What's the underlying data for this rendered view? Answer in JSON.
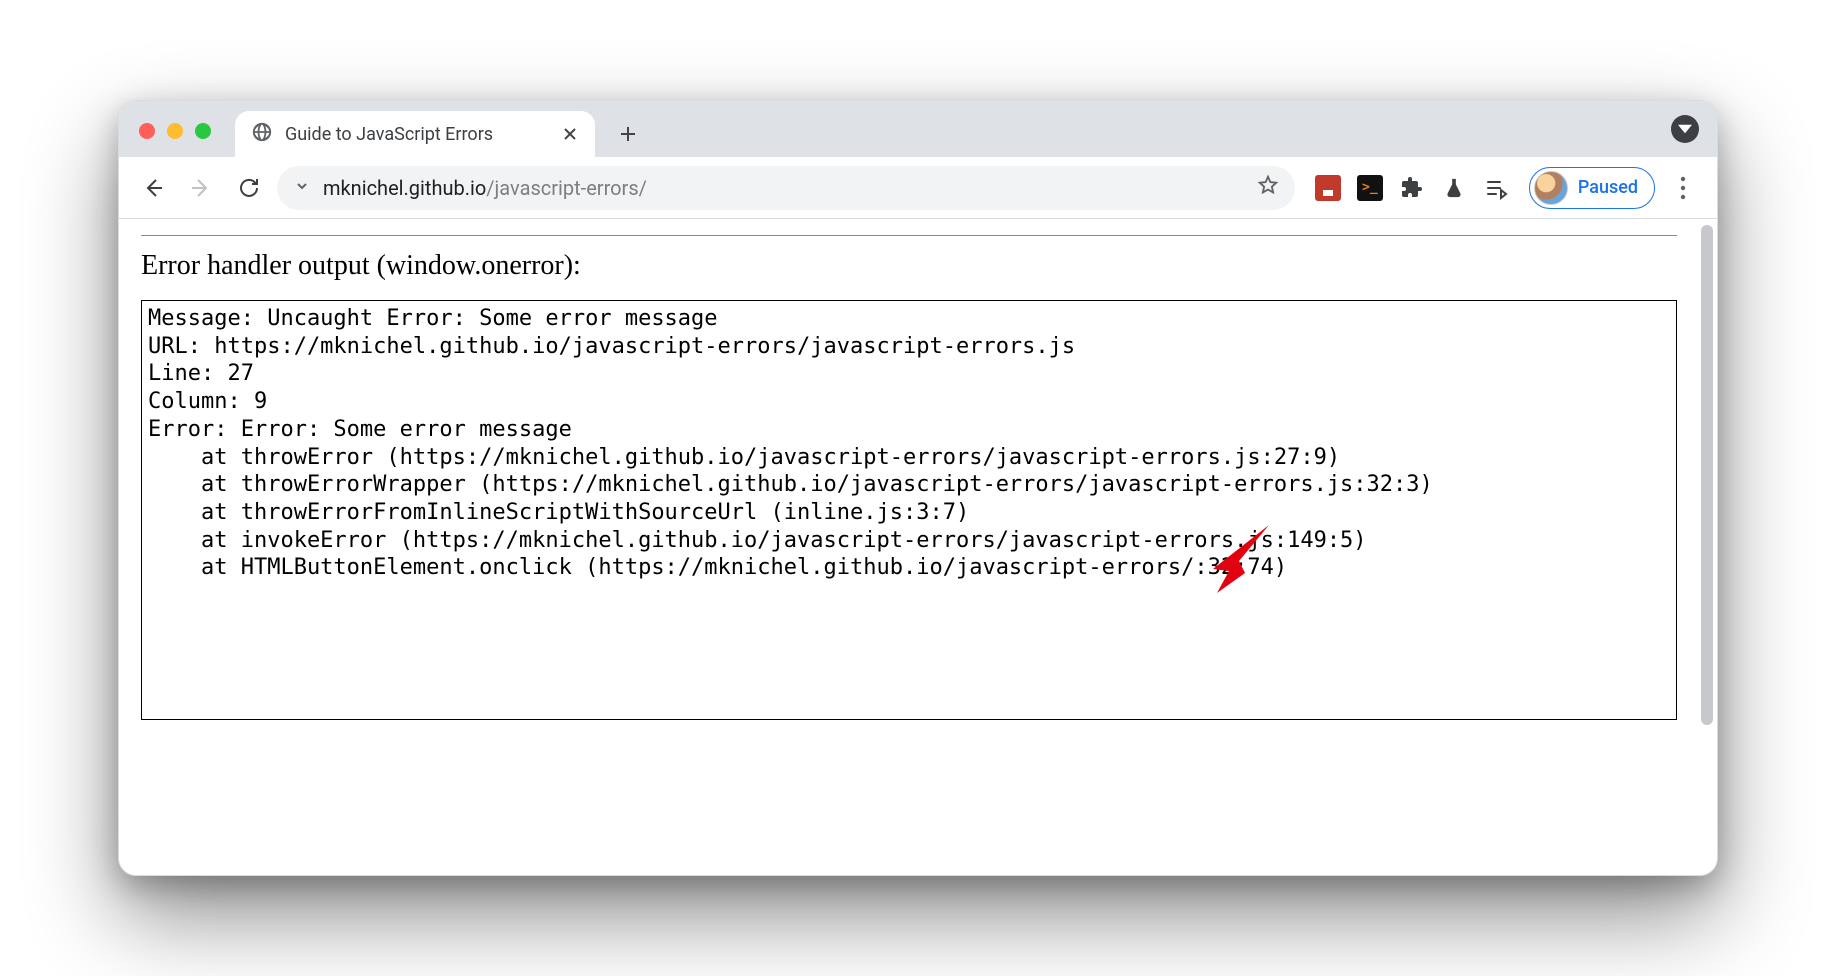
{
  "tab": {
    "title": "Guide to JavaScript Errors"
  },
  "url": {
    "host": "mknichel.github.io",
    "path": "/javascript-errors/"
  },
  "profile": {
    "status": "Paused"
  },
  "extensions": {
    "terminal_glyph": ">_"
  },
  "page": {
    "heading": "Error handler output (window.onerror):",
    "error": {
      "message": "Uncaught Error: Some error message",
      "url": "https://mknichel.github.io/javascript-errors/javascript-errors.js",
      "line": 27,
      "column": 9,
      "error_name": "Error: Some error message",
      "stack": [
        "at throwError (https://mknichel.github.io/javascript-errors/javascript-errors.js:27:9)",
        "at throwErrorWrapper (https://mknichel.github.io/javascript-errors/javascript-errors.js:32:3)",
        "at throwErrorFromInlineScriptWithSourceUrl (inline.js:3:7)",
        "at invokeError (https://mknichel.github.io/javascript-errors/javascript-errors.js:149:5)",
        "at HTMLButtonElement.onclick (https://mknichel.github.io/javascript-errors/:32:74)"
      ]
    },
    "labels": {
      "message": "Message: ",
      "url": "URL: ",
      "line": "Line: ",
      "column": "Column: ",
      "error": "Error: "
    }
  }
}
